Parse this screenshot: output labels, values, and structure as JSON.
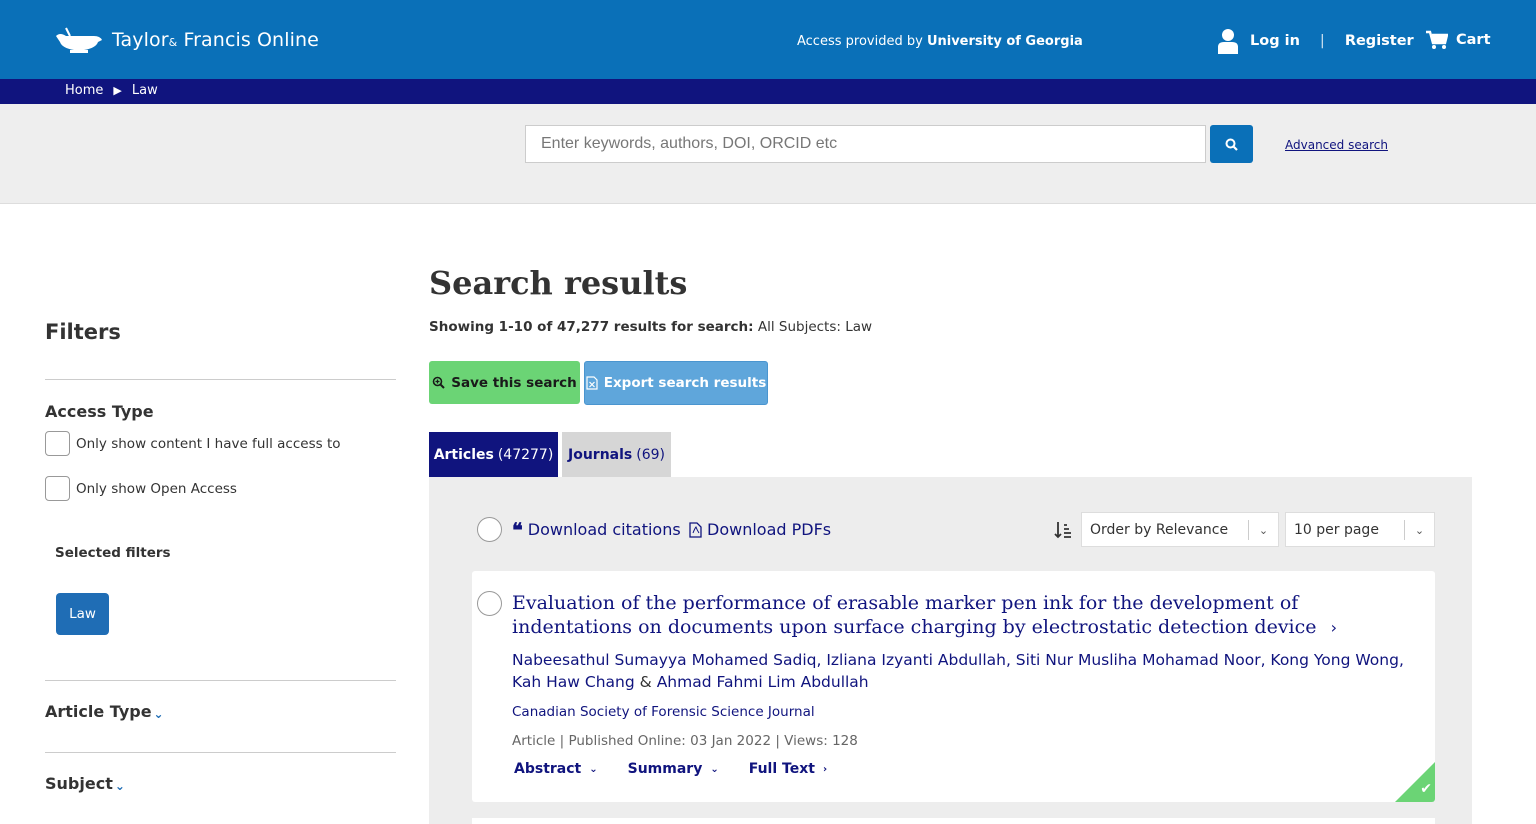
{
  "header": {
    "logo_name": "Taylor",
    "logo_amp": "&",
    "logo_rest": "Francis Online",
    "access_prefix": "Access provided by",
    "access_org": "University of Georgia",
    "login": "Log in",
    "separator": "|",
    "register": "Register",
    "cart": "Cart"
  },
  "breadcrumb": {
    "home": "Home",
    "current": "Law"
  },
  "search": {
    "placeholder": "Enter keywords, authors, DOI, ORCID etc",
    "advanced": "Advanced search"
  },
  "sidebar": {
    "title": "Filters",
    "access_type": "Access Type",
    "opt_full_access": "Only show content I have full access to",
    "opt_open_access": "Only show Open Access",
    "selected_filters": "Selected filters",
    "chip": "Law",
    "article_type": "Article Type",
    "subject": "Subject"
  },
  "main": {
    "title": "Search results",
    "showing_bold": "Showing 1-10 of 47,277 results for search:",
    "showing_rest": "All Subjects: Law",
    "save_btn": "Save this search",
    "export_btn": "Export search results",
    "tab_articles": "Articles",
    "tab_articles_count": "(47277)",
    "tab_journals": "Journals",
    "tab_journals_count": "(69)",
    "download_citations": "Download citations",
    "download_pdfs": "Download PDFs",
    "order": "Order by Relevance",
    "per_page": "10 per page"
  },
  "result": {
    "title": "Evaluation of the performance of erasable marker pen ink for the development of indentations on documents upon surface charging by electrostatic detection device",
    "authors_before": "Nabeesathul Sumayya Mohamed Sadiq, Izliana Izyanti Abdullah, Siti Nur Musliha Mohamad Noor, Kong Yong Wong, Kah Haw Chang",
    "authors_amp": "&",
    "authors_last": "Ahmad Fahmi Lim Abdullah",
    "journal": "Canadian Society of Forensic Science Journal",
    "meta": "Article | Published Online: 03 Jan 2022 | Views: 128",
    "abstract": "Abstract",
    "summary": "Summary",
    "full_text": "Full Text"
  },
  "colors": {
    "brand_blue": "#0a70b8",
    "navy": "#10147e",
    "green": "#6bd475",
    "export_blue": "#5fa6db"
  }
}
